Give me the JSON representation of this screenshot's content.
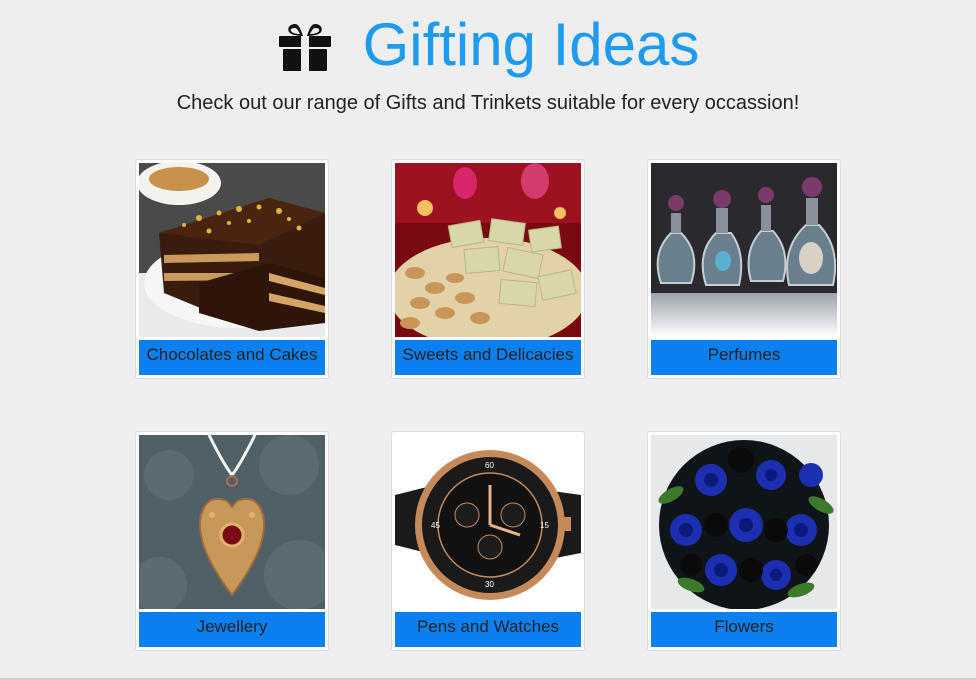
{
  "header": {
    "title": "Gifting Ideas",
    "icon": "gift-icon",
    "subtitle": "Check out our range of Gifts and Trinkets suitable for every occassion!"
  },
  "colors": {
    "title": "#1c9bf0",
    "label_background": "#0a7ff0",
    "page_background": "#eeeeee"
  },
  "categories": [
    {
      "label": "Chocolates and Cakes",
      "image": "chocolate-cake-image"
    },
    {
      "label": "Sweets and Delicacies",
      "image": "sweets-image"
    },
    {
      "label": "Perfumes",
      "image": "perfume-bottles-image"
    },
    {
      "label": "Jewellery",
      "image": "heart-pendant-image"
    },
    {
      "label": "Pens and Watches",
      "image": "watch-image"
    },
    {
      "label": "Flowers",
      "image": "blue-roses-image"
    }
  ]
}
